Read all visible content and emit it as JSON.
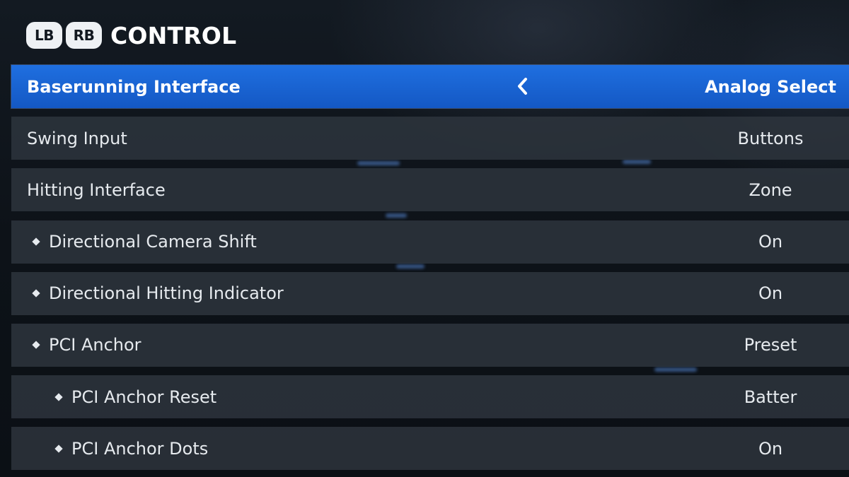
{
  "header": {
    "lb_label": "LB",
    "rb_label": "RB",
    "title": "CONTROL"
  },
  "settings": [
    {
      "label": "Baserunning Interface",
      "value": "Analog Select",
      "indent": 0,
      "selected": true
    },
    {
      "label": "Swing Input",
      "value": "Buttons",
      "indent": 0
    },
    {
      "label": "Hitting Interface",
      "value": "Zone",
      "indent": 0
    },
    {
      "label": "Directional Camera Shift",
      "value": "On",
      "indent": 1
    },
    {
      "label": "Directional Hitting Indicator",
      "value": "On",
      "indent": 1
    },
    {
      "label": "PCI Anchor",
      "value": "Preset",
      "indent": 1
    },
    {
      "label": "PCI Anchor Reset",
      "value": "Batter",
      "indent": 2
    },
    {
      "label": "PCI Anchor Dots",
      "value": "On",
      "indent": 2
    }
  ],
  "icons": {
    "left_arrow": "chevron-left-icon",
    "sub_bullet": "diamond-bullet-icon"
  },
  "colors": {
    "selected_row": "#1f6fe0",
    "row_background": "#2e363e",
    "text": "#e6eaee"
  }
}
